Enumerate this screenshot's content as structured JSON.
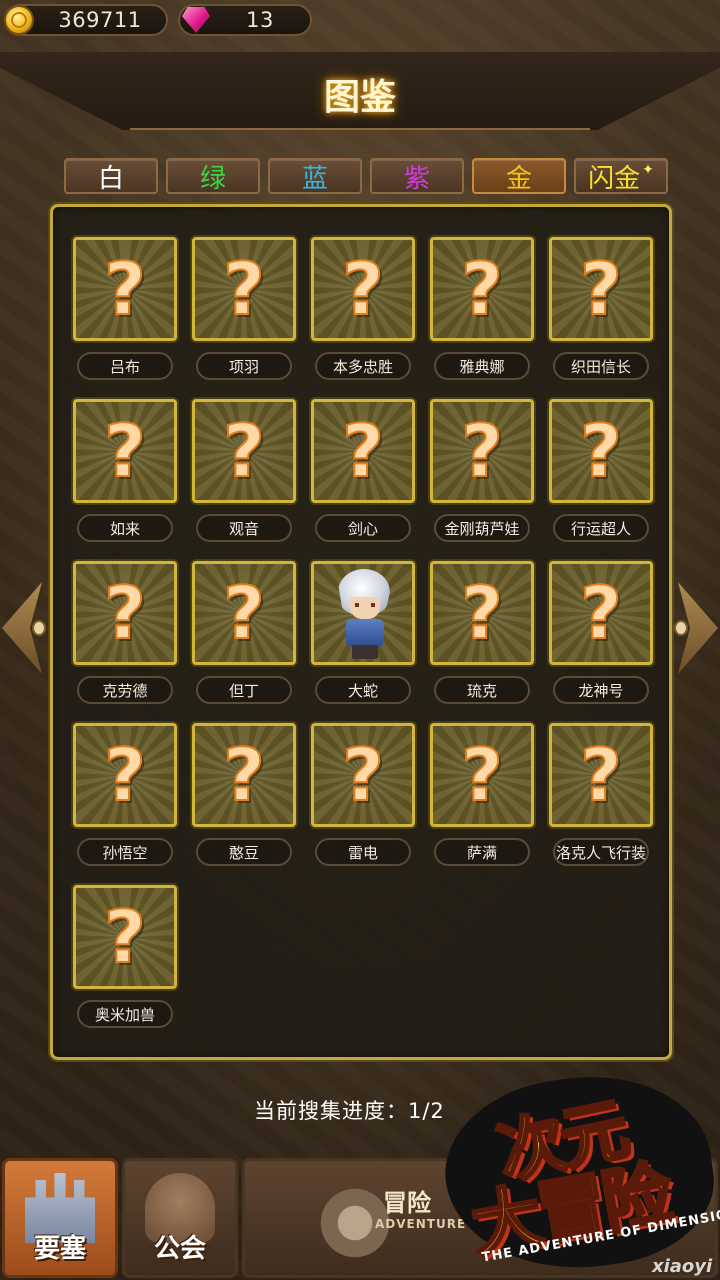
{
  "resources": {
    "coins": "369711",
    "gems": "13",
    "coin_icon": "coin-icon",
    "gem_icon": "gem-icon"
  },
  "title": "图鉴",
  "tabs": [
    {
      "label": "白",
      "color": "#ffffff"
    },
    {
      "label": "绿",
      "color": "#3ed24a"
    },
    {
      "label": "蓝",
      "color": "#2fb8ea"
    },
    {
      "label": "紫",
      "color": "#d13ae0"
    },
    {
      "label": "金",
      "color": "#f5c21c",
      "active": true
    },
    {
      "label": "闪金",
      "color": "#f5e02a"
    }
  ],
  "cards": [
    {
      "name": "吕布",
      "locked": true
    },
    {
      "name": "项羽",
      "locked": true
    },
    {
      "name": "本多忠胜",
      "locked": true
    },
    {
      "name": "雅典娜",
      "locked": true
    },
    {
      "name": "织田信长",
      "locked": true
    },
    {
      "name": "如来",
      "locked": true
    },
    {
      "name": "观音",
      "locked": true
    },
    {
      "name": "剑心",
      "locked": true
    },
    {
      "name": "金刚葫芦娃",
      "locked": true
    },
    {
      "name": "行运超人",
      "locked": true
    },
    {
      "name": "克劳德",
      "locked": true
    },
    {
      "name": "但丁",
      "locked": true
    },
    {
      "name": "大蛇",
      "locked": false
    },
    {
      "name": "琉克",
      "locked": true
    },
    {
      "name": "龙神号",
      "locked": true
    },
    {
      "name": "孙悟空",
      "locked": true
    },
    {
      "name": "憨豆",
      "locked": true
    },
    {
      "name": "雷电",
      "locked": true
    },
    {
      "name": "萨满",
      "locked": true
    },
    {
      "name": "洛克人飞行装",
      "locked": true
    },
    {
      "name": "奥米加兽",
      "locked": true
    }
  ],
  "locked_symbol": "?",
  "progress": "当前搜集进度：1/2",
  "nav": {
    "fortress": "要塞",
    "guild": "公会",
    "adventure": "冒险",
    "adventure_sub": "ADVENTURE"
  },
  "logo": {
    "line1": "次元",
    "line2": "大冒险",
    "tagline": "THE ADVENTURE OF DIMENSION"
  },
  "watermark": "xiaoyi"
}
